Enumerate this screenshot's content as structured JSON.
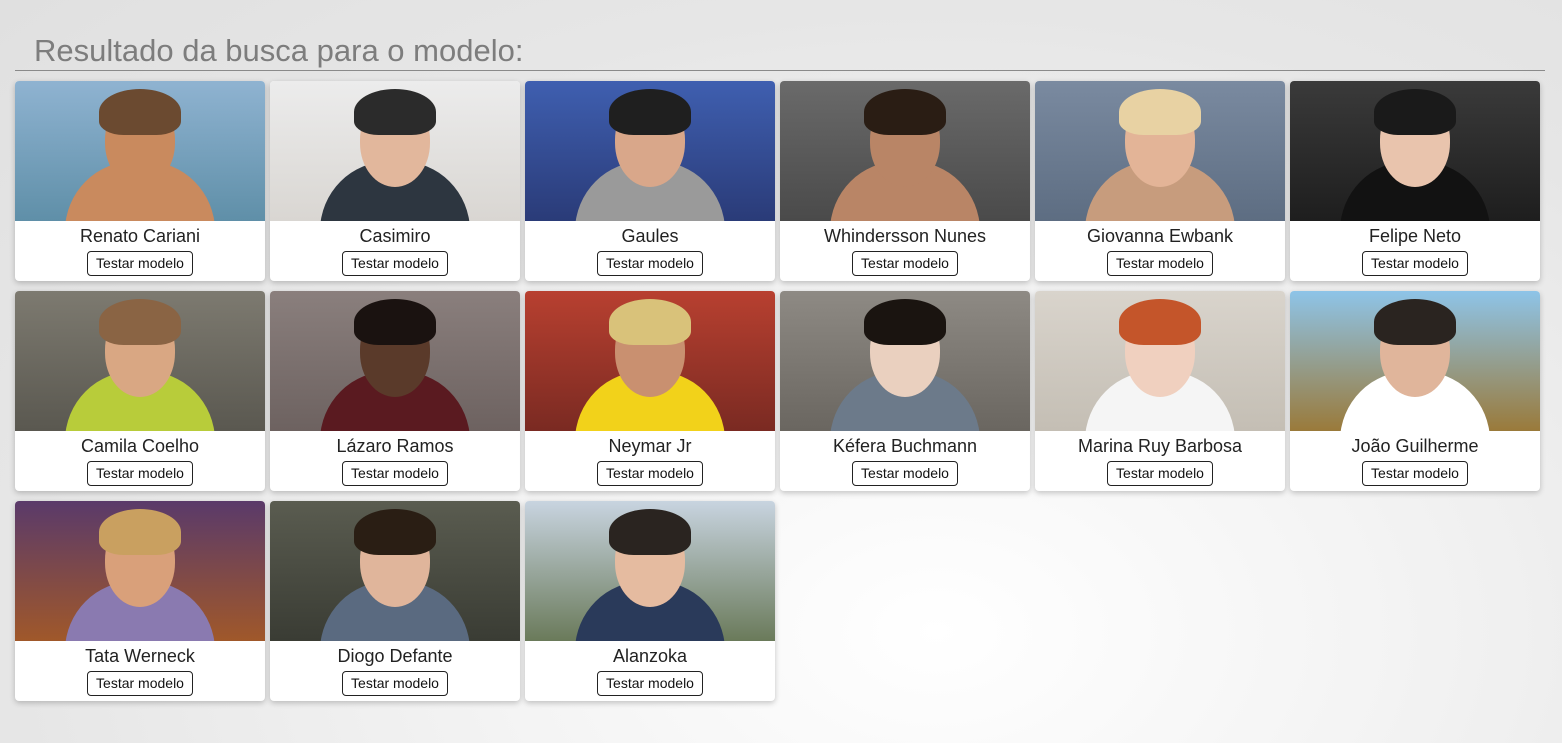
{
  "header": {
    "title": "Resultado da busca para o modelo:"
  },
  "cards": [
    {
      "name": "Renato Cariani",
      "button": "Testar modelo",
      "colors": {
        "bg": "#8fb3d1",
        "bg2": "#5f8fa8",
        "skin": "#c98a5e",
        "hair": "#6b4a30",
        "body": "#c98a5e"
      }
    },
    {
      "name": "Casimiro",
      "button": "Testar modelo",
      "colors": {
        "bg": "#ececec",
        "bg2": "#d9d6d2",
        "skin": "#e2b79c",
        "hair": "#2b2b2b",
        "body": "#2d3640"
      }
    },
    {
      "name": "Gaules",
      "button": "Testar modelo",
      "colors": {
        "bg": "#3f5fb0",
        "bg2": "#2a3b78",
        "skin": "#d9a78a",
        "hair": "#1f1f1f",
        "body": "#9a9a9a"
      }
    },
    {
      "name": "Whindersson Nunes",
      "button": "Testar modelo",
      "colors": {
        "bg": "#6a6a6a",
        "bg2": "#4a4a4a",
        "skin": "#b98566",
        "hair": "#2a1d14",
        "body": "#b98566"
      }
    },
    {
      "name": "Giovanna Ewbank",
      "button": "Testar modelo",
      "colors": {
        "bg": "#7a8aa0",
        "bg2": "#5d6d82",
        "skin": "#e3b497",
        "hair": "#e8d2a3",
        "body": "#c79c7d"
      }
    },
    {
      "name": "Felipe Neto",
      "button": "Testar modelo",
      "colors": {
        "bg": "#3a3a3a",
        "bg2": "#1e1e1e",
        "skin": "#e9c4ad",
        "hair": "#1a1a1a",
        "body": "#121212"
      }
    },
    {
      "name": "Camila Coelho",
      "button": "Testar modelo",
      "colors": {
        "bg": "#7d7a70",
        "bg2": "#5a5850",
        "skin": "#d9a783",
        "hair": "#8a6444",
        "body": "#b8cc3a"
      }
    },
    {
      "name": "Lázaro Ramos",
      "button": "Testar modelo",
      "colors": {
        "bg": "#8a7f7d",
        "bg2": "#6d6260",
        "skin": "#5a3a2a",
        "hair": "#1a1210",
        "body": "#5a1a20"
      }
    },
    {
      "name": "Neymar Jr",
      "button": "Testar modelo",
      "colors": {
        "bg": "#b84030",
        "bg2": "#7a2a22",
        "skin": "#c99070",
        "hair": "#d9c27a",
        "body": "#f2d21a"
      }
    },
    {
      "name": "Kéfera Buchmann",
      "button": "Testar modelo",
      "colors": {
        "bg": "#8e8a84",
        "bg2": "#6a6660",
        "skin": "#ead0bf",
        "hair": "#1a1410",
        "body": "#6c7a8a"
      }
    },
    {
      "name": "Marina Ruy Barbosa",
      "button": "Testar modelo",
      "colors": {
        "bg": "#d9d4cc",
        "bg2": "#c4beb4",
        "skin": "#f0d0bf",
        "hair": "#c4552a",
        "body": "#f5f5f5"
      }
    },
    {
      "name": "João Guilherme",
      "button": "Testar modelo",
      "colors": {
        "bg": "#8ec4e8",
        "bg2": "#9a7a3a",
        "skin": "#e0b59b",
        "hair": "#2a2420",
        "body": "#ffffff"
      }
    },
    {
      "name": "Tata Werneck",
      "button": "Testar modelo",
      "colors": {
        "bg": "#5a3a6a",
        "bg2": "#a0582a",
        "skin": "#d9a07a",
        "hair": "#c9a060",
        "body": "#8a7ab0"
      }
    },
    {
      "name": "Diogo Defante",
      "button": "Testar modelo",
      "colors": {
        "bg": "#5a5c50",
        "bg2": "#3a3c34",
        "skin": "#e0b59b",
        "hair": "#2a1e14",
        "body": "#5a6a80"
      }
    },
    {
      "name": "Alanzoka",
      "button": "Testar modelo",
      "colors": {
        "bg": "#c8d4e0",
        "bg2": "#6a7a5a",
        "skin": "#e5bba0",
        "hair": "#2a2420",
        "body": "#2a3a5a"
      }
    }
  ]
}
